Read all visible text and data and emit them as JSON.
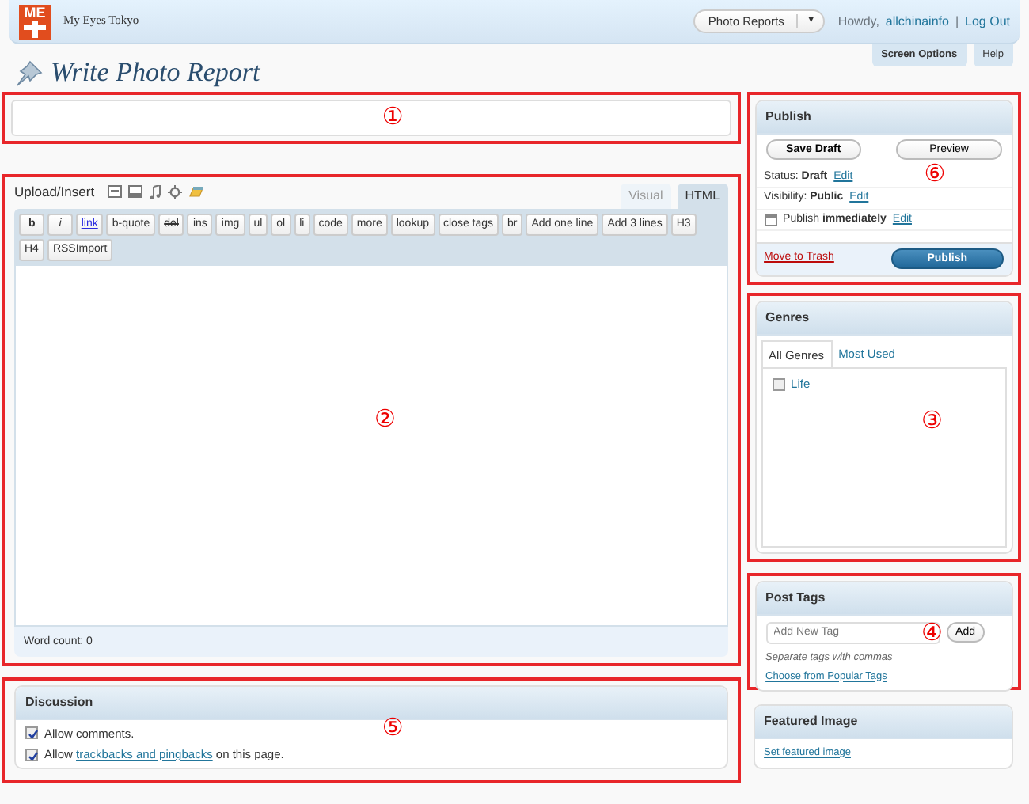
{
  "header": {
    "logo_text": "ME",
    "site_title": "My Eyes Tokyo",
    "dropdown": "Photo Reports",
    "dropdown_caret": "▼",
    "howdy": "Howdy,",
    "user": "allchinainfo",
    "separator": "|",
    "logout": "Log Out"
  },
  "screen_tabs": [
    "Screen Options",
    "Help"
  ],
  "page_title": "Write Photo Report",
  "title_box": {
    "annotation": "①"
  },
  "editor": {
    "upload_label": "Upload/Insert",
    "annotation": "②",
    "word_count": "Word count: 0",
    "modes": [
      {
        "label": "Visual",
        "selected": false
      },
      {
        "label": "HTML",
        "selected": true
      }
    ],
    "quicktags": [
      {
        "label": "b",
        "kind": "bold"
      },
      {
        "label": "i",
        "kind": "italic"
      },
      {
        "label": "link",
        "kind": "link"
      },
      {
        "label": "b-quote",
        "kind": "plain"
      },
      {
        "label": "del",
        "kind": "strike"
      },
      {
        "label": "ins",
        "kind": "plain"
      },
      {
        "label": "img",
        "kind": "plain"
      },
      {
        "label": "ul",
        "kind": "plain"
      },
      {
        "label": "ol",
        "kind": "plain"
      },
      {
        "label": "li",
        "kind": "plain"
      },
      {
        "label": "code",
        "kind": "plain"
      },
      {
        "label": "more",
        "kind": "plain"
      },
      {
        "label": "lookup",
        "kind": "plain"
      },
      {
        "label": "close tags",
        "kind": "plain"
      },
      {
        "label": "br",
        "kind": "plain"
      },
      {
        "label": "Add one line",
        "kind": "plain"
      },
      {
        "label": "Add 3 lines",
        "kind": "plain"
      },
      {
        "label": "H3",
        "kind": "plain"
      },
      {
        "label": "H4",
        "kind": "plain"
      },
      {
        "label": "RSSImport",
        "kind": "plain"
      }
    ]
  },
  "discussion": {
    "title": "Discussion",
    "annotation": "⑤",
    "options": [
      {
        "before": "Allow comments.",
        "checked": true
      },
      {
        "before": "Allow ",
        "link": "trackbacks and pingbacks",
        "after": " on this page.",
        "checked": true
      }
    ]
  },
  "publish": {
    "title": "Publish",
    "save_draft": "Save Draft",
    "preview": "Preview",
    "annotation": "⑥",
    "trash": "Move to Trash",
    "publish_button": "Publish",
    "rows": [
      {
        "kind": "plain",
        "label": "Status:",
        "value": "Draft",
        "edit": "Edit"
      },
      {
        "kind": "plain",
        "label": "Visibility:",
        "value": "Public",
        "edit": "Edit"
      },
      {
        "kind": "calendar",
        "label": "Publish",
        "value": "immediately",
        "edit": "Edit"
      }
    ]
  },
  "genres": {
    "title": "Genres",
    "annotation": "③",
    "tabs": [
      {
        "label": "All Genres",
        "selected": true
      },
      {
        "label": "Most Used",
        "selected": false
      }
    ],
    "items": [
      {
        "label": "Life",
        "checked": false
      }
    ]
  },
  "post_tags": {
    "title": "Post Tags",
    "placeholder": "Add New Tag",
    "add": "Add",
    "hint": "Separate tags with commas",
    "popular": "Choose from Popular Tags",
    "annotation": "④"
  },
  "featured_image": {
    "title": "Featured Image",
    "link": "Set featured image"
  }
}
